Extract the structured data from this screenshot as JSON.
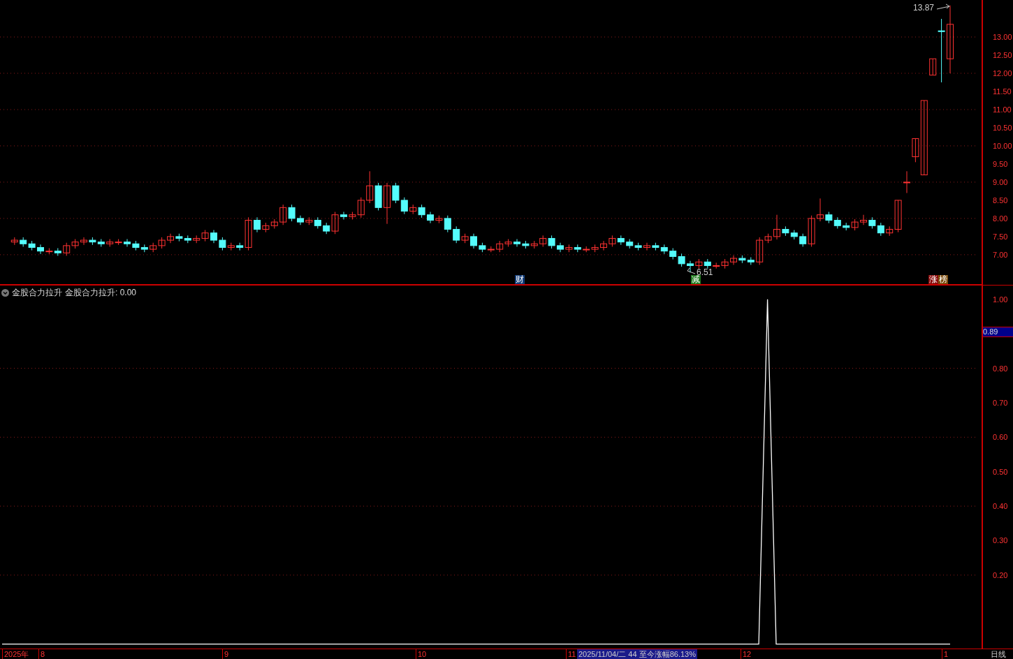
{
  "price_panel": {
    "high_label": "13.87",
    "low_label": "6.51",
    "chart_data": {
      "type": "candlestick",
      "grid": true,
      "ylim": [
        6.17,
        14.02
      ],
      "yticks": [
        {
          "value": 13,
          "label": "13.00"
        },
        {
          "value": 12.5,
          "label": "12.50"
        },
        {
          "value": 12,
          "label": "12.00"
        },
        {
          "value": 11.5,
          "label": "11.50"
        },
        {
          "value": 11,
          "label": "11.00"
        },
        {
          "value": 10.5,
          "label": "10.50"
        },
        {
          "value": 10,
          "label": "10.00"
        },
        {
          "value": 9.5,
          "label": "9.50"
        },
        {
          "value": 9,
          "label": "9.00"
        },
        {
          "value": 8.5,
          "label": "8.50"
        },
        {
          "value": 8,
          "label": "8.00"
        },
        {
          "value": 7.5,
          "label": "7.50"
        },
        {
          "value": 7,
          "label": "7.00"
        }
      ],
      "ohlc": [
        [
          7.35,
          7.48,
          7.27,
          7.4
        ],
        [
          7.4,
          7.48,
          7.22,
          7.3
        ],
        [
          7.3,
          7.38,
          7.12,
          7.2
        ],
        [
          7.2,
          7.28,
          7.02,
          7.1
        ],
        [
          7.1,
          7.18,
          7.02,
          7.1
        ],
        [
          7.1,
          7.18,
          6.97,
          7.05
        ],
        [
          7.05,
          7.33,
          6.97,
          7.25
        ],
        [
          7.25,
          7.43,
          7.17,
          7.35
        ],
        [
          7.35,
          7.48,
          7.27,
          7.4
        ],
        [
          7.4,
          7.48,
          7.27,
          7.35
        ],
        [
          7.35,
          7.43,
          7.22,
          7.3
        ],
        [
          7.3,
          7.43,
          7.22,
          7.35
        ],
        [
          7.35,
          7.43,
          7.27,
          7.35
        ],
        [
          7.35,
          7.43,
          7.22,
          7.3
        ],
        [
          7.3,
          7.38,
          7.12,
          7.2
        ],
        [
          7.2,
          7.28,
          7.07,
          7.15
        ],
        [
          7.15,
          7.33,
          7.07,
          7.25
        ],
        [
          7.25,
          7.48,
          7.17,
          7.4
        ],
        [
          7.4,
          7.58,
          7.32,
          7.5
        ],
        [
          7.5,
          7.58,
          7.37,
          7.45
        ],
        [
          7.45,
          7.53,
          7.32,
          7.4
        ],
        [
          7.4,
          7.53,
          7.32,
          7.45
        ],
        [
          7.45,
          7.68,
          7.37,
          7.6
        ],
        [
          7.6,
          7.68,
          7.32,
          7.4
        ],
        [
          7.4,
          7.48,
          7.12,
          7.2
        ],
        [
          7.2,
          7.33,
          7.12,
          7.25
        ],
        [
          7.25,
          7.33,
          7.12,
          7.2
        ],
        [
          7.2,
          8.03,
          7.12,
          7.95
        ],
        [
          7.95,
          8.03,
          7.62,
          7.7
        ],
        [
          7.7,
          7.88,
          7.62,
          7.8
        ],
        [
          7.8,
          7.98,
          7.72,
          7.9
        ],
        [
          7.9,
          8.38,
          7.82,
          8.3
        ],
        [
          8.3,
          8.38,
          7.92,
          8.0
        ],
        [
          8.0,
          8.08,
          7.82,
          7.9
        ],
        [
          7.9,
          8.03,
          7.82,
          7.95
        ],
        [
          7.95,
          8.03,
          7.72,
          7.8
        ],
        [
          7.8,
          7.88,
          7.57,
          7.65
        ],
        [
          7.65,
          8.18,
          7.57,
          8.1
        ],
        [
          8.1,
          8.18,
          7.97,
          8.05
        ],
        [
          8.05,
          8.18,
          7.97,
          8.1
        ],
        [
          8.1,
          8.58,
          8.02,
          8.5
        ],
        [
          8.5,
          9.3,
          8.42,
          8.9
        ],
        [
          8.9,
          8.98,
          8.22,
          8.3
        ],
        [
          8.3,
          8.98,
          7.85,
          8.9
        ],
        [
          8.9,
          8.98,
          8.42,
          8.5
        ],
        [
          8.5,
          8.58,
          8.12,
          8.2
        ],
        [
          8.2,
          8.38,
          8.12,
          8.3
        ],
        [
          8.3,
          8.38,
          8.02,
          8.1
        ],
        [
          8.1,
          8.18,
          7.87,
          7.95
        ],
        [
          7.95,
          8.08,
          7.87,
          8.0
        ],
        [
          8.0,
          8.08,
          7.62,
          7.7
        ],
        [
          7.7,
          7.78,
          7.32,
          7.4
        ],
        [
          7.4,
          7.58,
          7.32,
          7.5
        ],
        [
          7.5,
          7.58,
          7.17,
          7.25
        ],
        [
          7.25,
          7.33,
          7.07,
          7.15
        ],
        [
          7.15,
          7.23,
          7.07,
          7.15
        ],
        [
          7.15,
          7.38,
          7.07,
          7.3
        ],
        [
          7.3,
          7.43,
          7.22,
          7.35
        ],
        [
          7.35,
          7.43,
          7.22,
          7.3
        ],
        [
          7.3,
          7.38,
          7.17,
          7.25
        ],
        [
          7.25,
          7.38,
          7.17,
          7.3
        ],
        [
          7.3,
          7.53,
          7.22,
          7.45
        ],
        [
          7.45,
          7.53,
          7.17,
          7.25
        ],
        [
          7.25,
          7.33,
          7.07,
          7.15
        ],
        [
          7.15,
          7.28,
          7.07,
          7.2
        ],
        [
          7.2,
          7.28,
          7.07,
          7.15
        ],
        [
          7.15,
          7.23,
          7.07,
          7.15
        ],
        [
          7.15,
          7.28,
          7.07,
          7.2
        ],
        [
          7.2,
          7.38,
          7.12,
          7.3
        ],
        [
          7.3,
          7.53,
          7.22,
          7.45
        ],
        [
          7.45,
          7.53,
          7.27,
          7.35
        ],
        [
          7.35,
          7.43,
          7.17,
          7.25
        ],
        [
          7.25,
          7.33,
          7.12,
          7.2
        ],
        [
          7.2,
          7.33,
          7.12,
          7.25
        ],
        [
          7.25,
          7.33,
          7.12,
          7.2
        ],
        [
          7.2,
          7.28,
          7.02,
          7.1
        ],
        [
          7.1,
          7.18,
          6.87,
          6.95
        ],
        [
          6.95,
          7.03,
          6.67,
          6.75
        ],
        [
          6.75,
          6.83,
          6.51,
          6.7
        ],
        [
          6.7,
          6.88,
          6.62,
          6.8
        ],
        [
          6.8,
          6.88,
          6.62,
          6.7
        ],
        [
          6.7,
          6.78,
          6.62,
          6.7
        ],
        [
          6.7,
          6.88,
          6.62,
          6.8
        ],
        [
          6.8,
          6.98,
          6.72,
          6.9
        ],
        [
          6.9,
          6.98,
          6.77,
          6.85
        ],
        [
          6.85,
          6.93,
          6.72,
          6.8
        ],
        [
          6.8,
          7.48,
          6.72,
          7.4
        ],
        [
          7.4,
          7.58,
          7.32,
          7.5
        ],
        [
          7.5,
          8.1,
          7.42,
          7.7
        ],
        [
          7.7,
          7.78,
          7.52,
          7.6
        ],
        [
          7.6,
          7.68,
          7.42,
          7.5
        ],
        [
          7.5,
          7.58,
          7.22,
          7.3
        ],
        [
          7.3,
          8.08,
          7.22,
          8.0
        ],
        [
          8.0,
          8.55,
          7.92,
          8.1
        ],
        [
          8.1,
          8.18,
          7.87,
          7.95
        ],
        [
          7.95,
          8.03,
          7.72,
          7.8
        ],
        [
          7.8,
          7.88,
          7.67,
          7.75
        ],
        [
          7.75,
          7.98,
          7.67,
          7.9
        ],
        [
          7.9,
          8.1,
          7.82,
          7.95
        ],
        [
          7.95,
          8.03,
          7.72,
          7.8
        ],
        [
          7.8,
          7.88,
          7.52,
          7.6
        ],
        [
          7.6,
          7.78,
          7.52,
          7.7
        ],
        [
          7.7,
          8.5,
          7.62,
          8.5
        ],
        [
          9.0,
          9.3,
          8.7,
          9.0
        ],
        [
          9.7,
          10.2,
          9.55,
          10.2
        ],
        [
          9.2,
          11.25,
          9.2,
          11.25
        ],
        [
          11.95,
          12.4,
          11.95,
          12.4
        ],
        [
          13.17,
          13.5,
          11.75,
          13.15
        ],
        [
          12.4,
          13.87,
          12.0,
          13.35
        ]
      ]
    },
    "markers": [
      {
        "segments": [
          {
            "text": "财",
            "color": "#123c78"
          }
        ]
      },
      {
        "segments": [
          {
            "text": "减",
            "color": "#1f7a1f"
          }
        ]
      },
      {
        "segments": [
          {
            "text": "涨",
            "color": "#8a0b0b"
          },
          {
            "text": "榜",
            "color": "#7a4a0a"
          }
        ]
      }
    ]
  },
  "indicator_panel": {
    "value_label": "金股合力拉升: 0.00",
    "cursor_value": "0.89",
    "chart_data": {
      "type": "line",
      "grid": true,
      "ylim": [
        -0.013,
        1.04
      ],
      "yticks": [
        {
          "value": 1,
          "label": "1.00"
        },
        {
          "value": 0.8,
          "label": "0.80"
        },
        {
          "value": 0.7,
          "label": "0.70"
        },
        {
          "value": 0.6,
          "label": "0.60"
        },
        {
          "value": 0.5,
          "label": "0.50"
        },
        {
          "value": 0.4,
          "label": "0.40"
        },
        {
          "value": 0.3,
          "label": "0.30"
        },
        {
          "value": 0.2,
          "label": "0.20"
        }
      ],
      "series": [
        {
          "name": "金股合力拉升",
          "color": "#ffffff",
          "values": [
            0,
            0,
            0,
            0,
            0,
            0,
            0,
            0,
            0,
            0,
            0,
            0,
            0,
            0,
            0,
            0,
            0,
            0,
            0,
            0,
            0,
            0,
            0,
            0,
            0,
            0,
            0,
            0,
            0,
            0,
            0,
            0,
            0,
            0,
            0,
            0,
            0,
            0,
            0,
            0,
            0,
            0,
            0,
            0,
            0,
            0,
            0,
            0,
            0,
            0,
            0,
            0,
            0,
            0,
            0,
            0,
            0,
            0,
            0,
            0,
            0,
            0,
            0,
            0,
            0,
            0,
            0,
            0,
            0,
            0,
            0,
            0,
            0,
            0,
            0,
            0,
            0,
            0,
            0,
            0,
            0,
            0,
            0,
            0,
            0,
            0,
            0,
            0,
            1,
            0,
            0,
            0,
            0,
            0,
            0,
            0,
            0,
            0,
            0,
            0,
            0,
            0,
            0,
            0,
            0,
            0,
            0,
            0,
            0,
            0
          ]
        }
      ]
    }
  },
  "time_axis": {
    "labels": [
      "2025年",
      "8",
      "9",
      "10",
      "11",
      "12",
      "1"
    ],
    "info_badge": "2025/11/04/二 44 至今涨幅86.13%",
    "period": "日线"
  }
}
